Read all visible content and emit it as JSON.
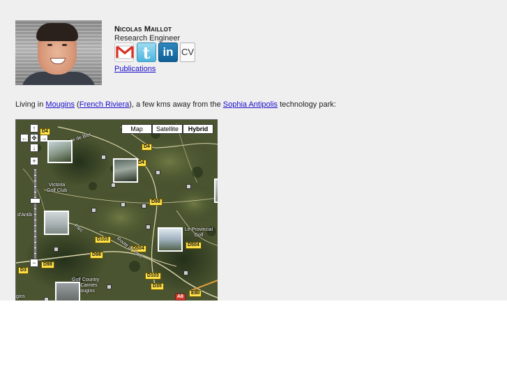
{
  "profile": {
    "name": "Nicolas Maillot",
    "role": "Research Engineer",
    "photo_alt": "portrait",
    "social": [
      {
        "icon": "gmail-icon",
        "color": "#d93025"
      },
      {
        "icon": "twitter-icon",
        "label": "t",
        "color": "#4bb5de"
      },
      {
        "icon": "linkedin-icon",
        "label": "in",
        "color": "#0e5f96"
      },
      {
        "icon": "cv-icon",
        "label": "CV"
      }
    ],
    "publications_label": "Publications"
  },
  "intro": {
    "prefix": "Living in ",
    "link_mougins": "Mougins",
    "paren_open": " (",
    "link_riviera": "French Riviera",
    "middle": "), a few kms away from the ",
    "link_sophia": "Sophia Antipolis",
    "suffix": " technology park:"
  },
  "map": {
    "types": [
      "Map",
      "Satellite",
      "Hybrid"
    ],
    "selected_type": "Hybrid",
    "roads": [
      "D4",
      "D4",
      "D4",
      "D98",
      "D103",
      "D504",
      "D504",
      "D98",
      "D98",
      "D3",
      "D103",
      "D35",
      "E80",
      "A8"
    ],
    "places": {
      "victoria": "Victoria\nGolf Club",
      "golf_country": "Golf Country\nde Cannes\nMougins",
      "provincial": "Le Provincial\nGolf",
      "antibes": "d'Antib",
      "route_biot": "Route de Biot",
      "route_parc": "Route du Parc",
      "parc": "Parc",
      "mougins_edge": "gins"
    },
    "controls": {
      "up": "↑",
      "left": "←",
      "center": "✥",
      "right": "→",
      "down": "↓",
      "zoom_in": "+",
      "zoom_out": "−"
    }
  },
  "colors": {
    "link": "#1a0dcc",
    "page_bg": "#efefef",
    "road_shield": "#ffe14a"
  }
}
